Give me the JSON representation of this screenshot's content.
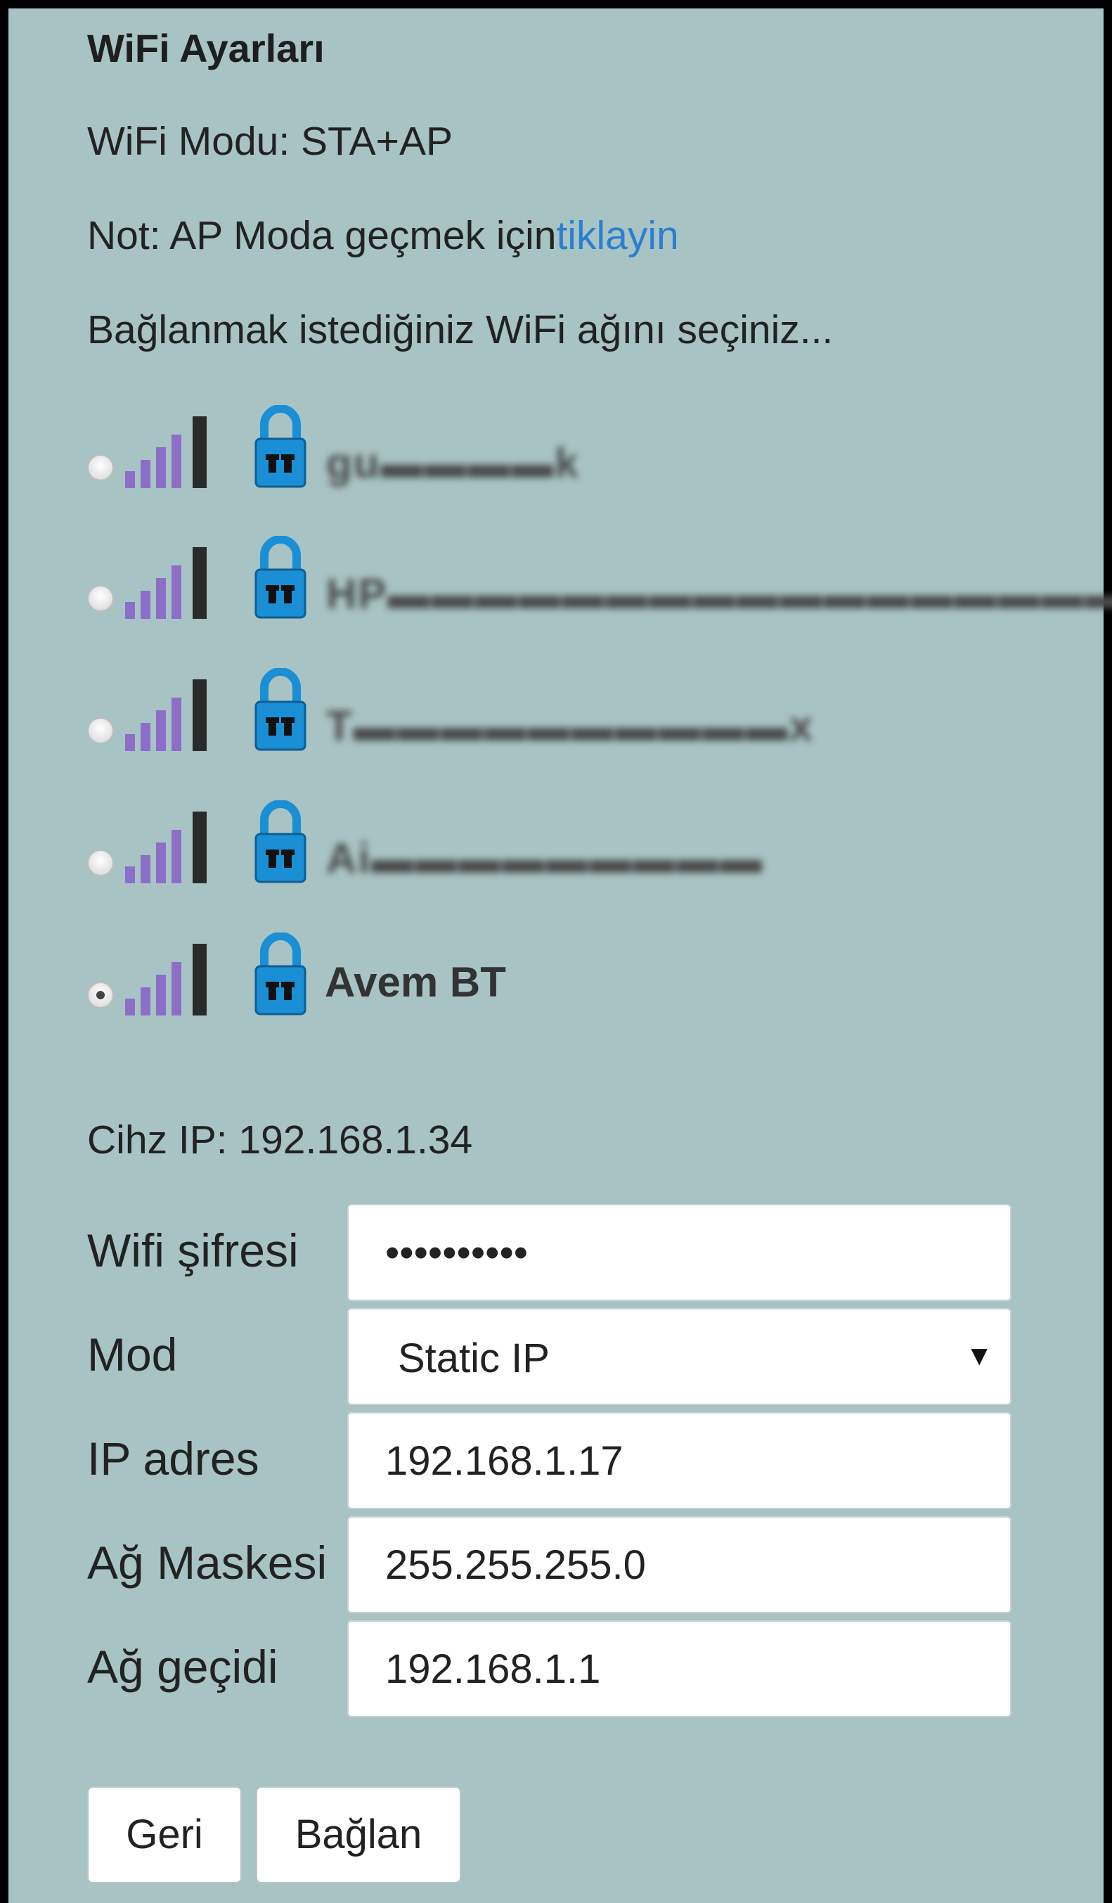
{
  "header": {
    "title": "WiFi Ayarları",
    "mode_text": "WiFi Modu: STA+AP",
    "note_prefix": "Not: AP Moda geçmek için",
    "note_link": "tiklayin",
    "instruction": "Bağlanmak istediğiniz WiFi ağını seçiniz..."
  },
  "networks": [
    {
      "ssid": "gu▬▬▬▬k",
      "redacted": true,
      "selected": false,
      "secured": true
    },
    {
      "ssid": "HP▬▬▬▬▬▬▬▬▬▬▬▬▬▬▬▬▬p",
      "redacted": true,
      "selected": false,
      "secured": true
    },
    {
      "ssid": "T▬▬▬▬▬▬▬▬▬▬x",
      "redacted": true,
      "selected": false,
      "secured": true
    },
    {
      "ssid": "Ai▬▬▬▬▬▬▬▬▬",
      "redacted": true,
      "selected": false,
      "secured": true
    },
    {
      "ssid": "Avem BT",
      "redacted": false,
      "selected": true,
      "secured": true
    }
  ],
  "device_ip": "Cihz IP: 192.168.1.34",
  "form": {
    "password_label": "Wifi şifresi",
    "password_value": "••••••••••",
    "mode_label": "Mod",
    "mode_value": "Static IP",
    "ip_label": "IP adres",
    "ip_value": "192.168.1.17",
    "mask_label": "Ağ Maskesi",
    "mask_value": "255.255.255.0",
    "gateway_label": "Ağ geçidi",
    "gateway_value": "192.168.1.1"
  },
  "buttons": {
    "back": "Geri",
    "connect": "Bağlan"
  },
  "colors": {
    "background": "#a8c3c3",
    "link": "#2b7fd1",
    "signal_bar": "#8c6ec8",
    "lock": "#1a8fd6"
  }
}
